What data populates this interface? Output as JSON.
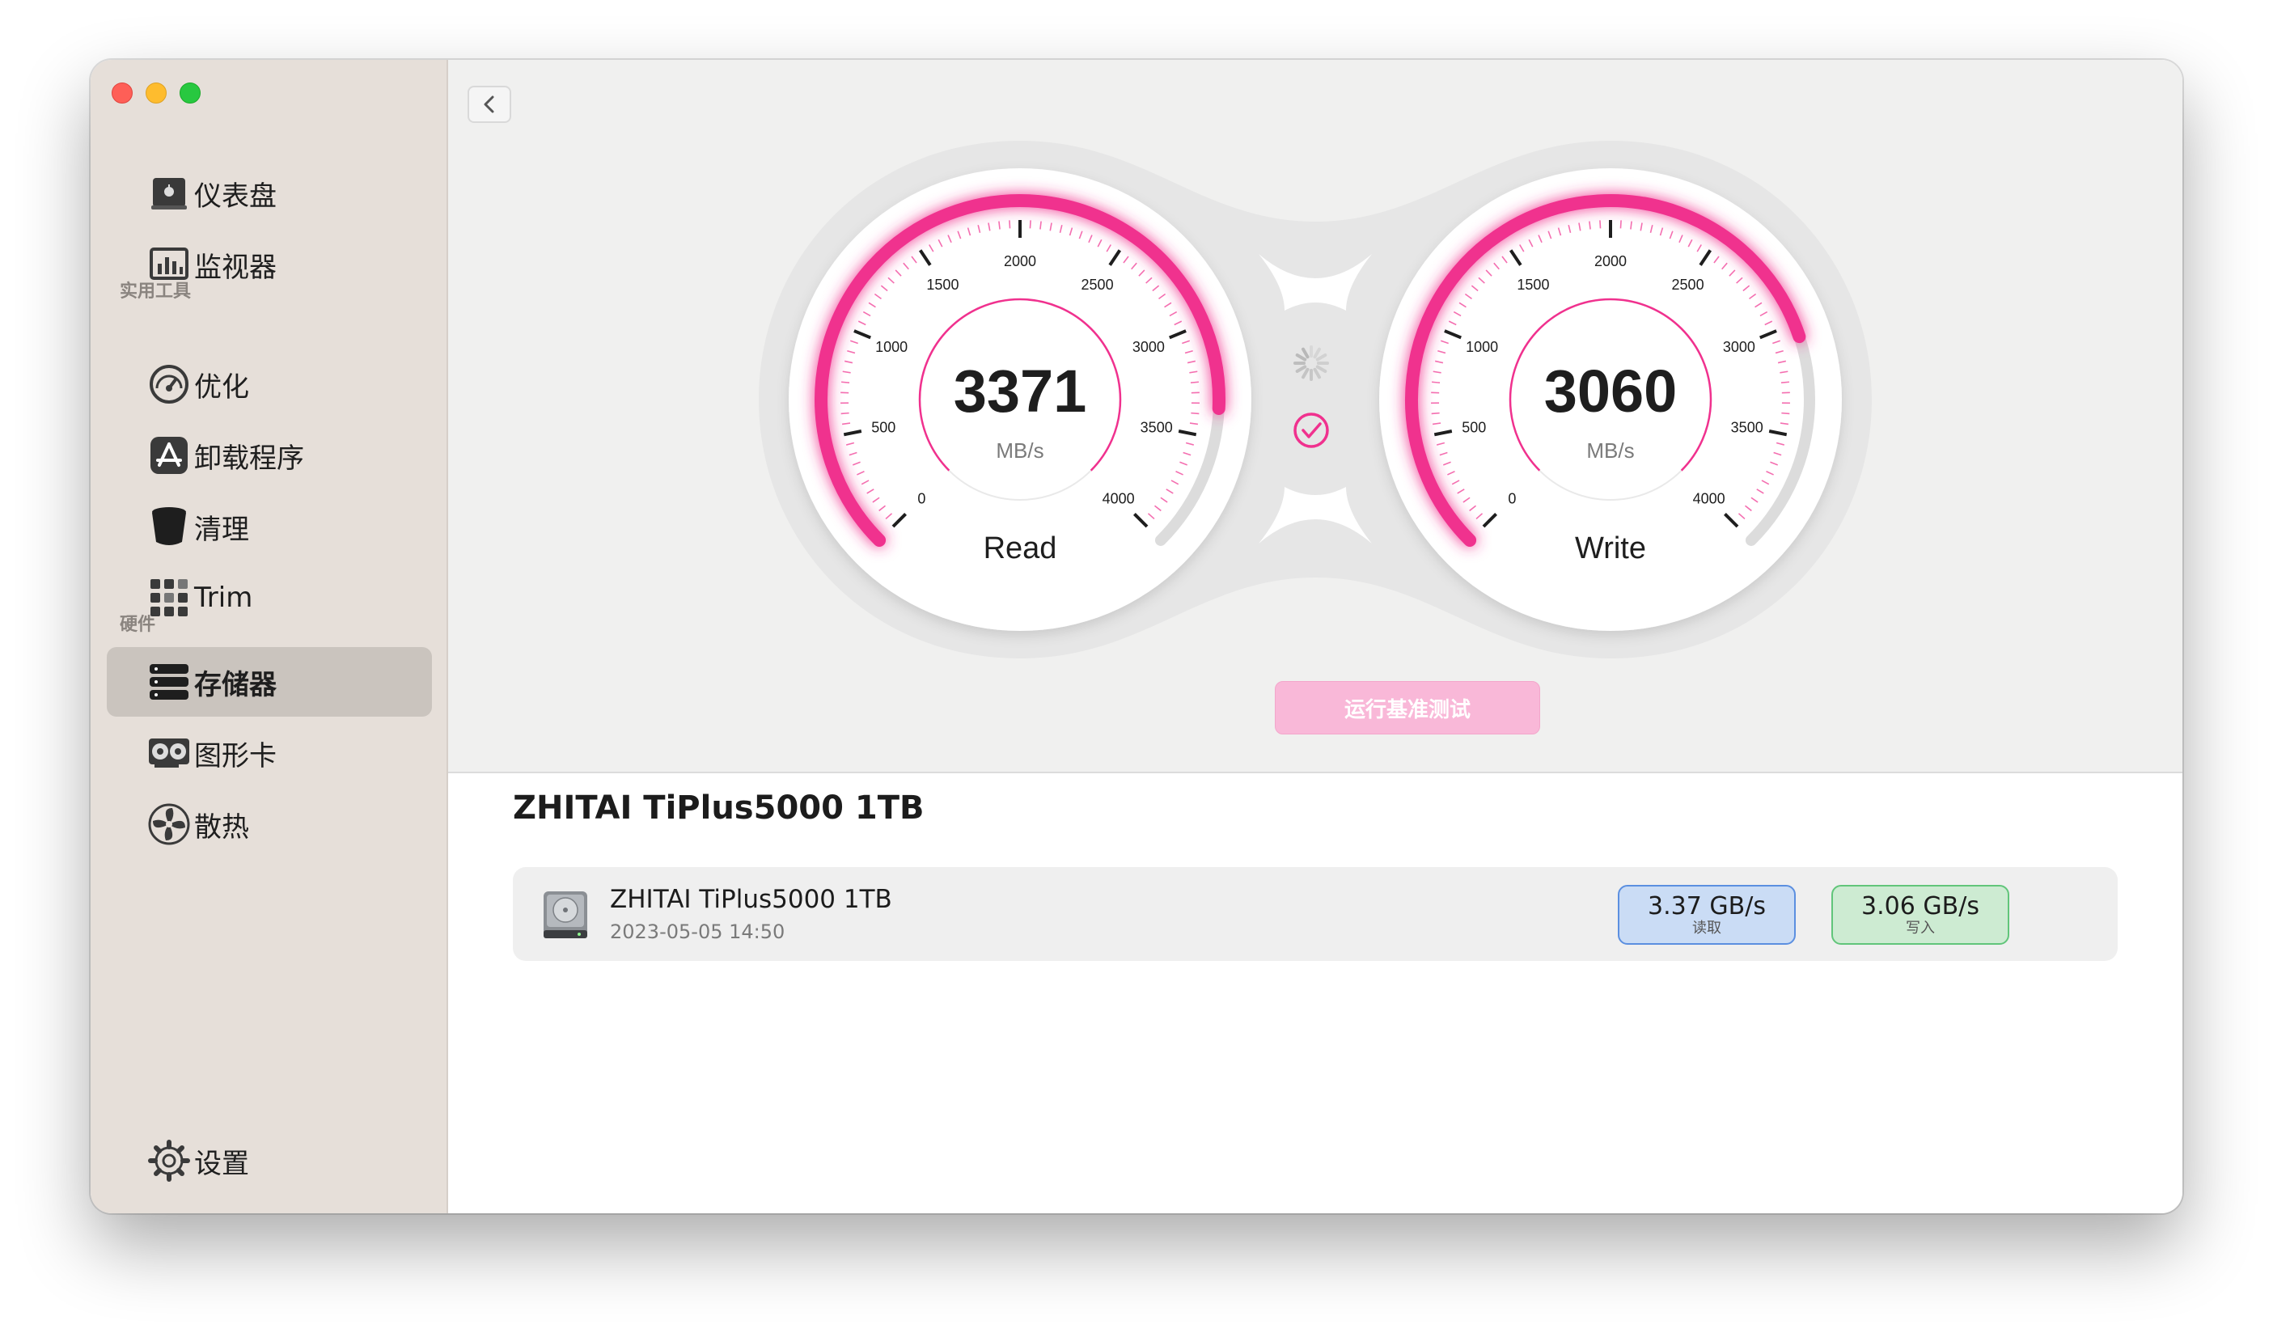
{
  "sidebar": {
    "items": [
      {
        "label": "仪表盘",
        "icon": "dashboard-icon"
      },
      {
        "label": "监视器",
        "icon": "monitor-icon"
      }
    ],
    "section_tools": "实用工具",
    "tools": [
      {
        "label": "优化",
        "icon": "gauge-icon"
      },
      {
        "label": "卸载程序",
        "icon": "app-store-icon"
      },
      {
        "label": "清理",
        "icon": "trash-bin-icon"
      },
      {
        "label": "Trim",
        "icon": "grid-icon"
      }
    ],
    "section_hardware": "硬件",
    "hardware": [
      {
        "label": "存储器",
        "icon": "storage-icon",
        "active": true
      },
      {
        "label": "图形卡",
        "icon": "graphics-card-icon"
      },
      {
        "label": "散热",
        "icon": "fan-icon"
      }
    ],
    "settings_label": "设置"
  },
  "gauges": {
    "read": {
      "value": "3371",
      "unit": "MB/s",
      "label": "Read",
      "fraction": 0.8428
    },
    "write": {
      "value": "3060",
      "unit": "MB/s",
      "label": "Write",
      "fraction": 0.765
    },
    "ticks": [
      "0",
      "500",
      "1000",
      "1500",
      "2000",
      "2500",
      "3000",
      "3500",
      "4000"
    ],
    "accent": "#f0318e"
  },
  "run_button_label": "运行基准测试",
  "device": {
    "title": "ZHITAI TiPlus5000 1TB",
    "name": "ZHITAI TiPlus5000 1TB",
    "date": "2023-05-05 14:50",
    "read_value": "3.37 GB/s",
    "read_label": "读取",
    "write_value": "3.06 GB/s",
    "write_label": "写入"
  }
}
